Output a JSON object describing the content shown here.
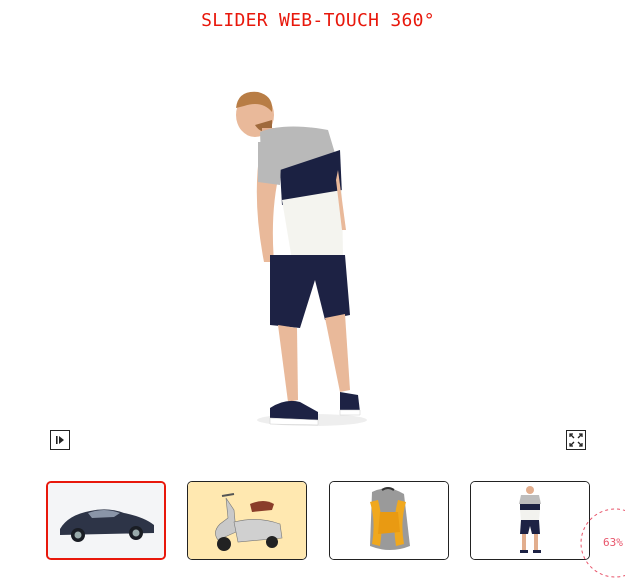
{
  "page": {
    "title": "SLIDER WEB-TOUCH 360°"
  },
  "viewer": {
    "current_item": "t-shirt-model",
    "controls": {
      "play_icon": "play-pause-icon",
      "fullscreen_icon": "fullscreen-icon"
    }
  },
  "thumbnails": [
    {
      "name": "car",
      "active": true,
      "background": "#ffffff"
    },
    {
      "name": "scooter",
      "active": false,
      "background": "#ffe8b0"
    },
    {
      "name": "backpack",
      "active": false,
      "background": "#ffffff"
    },
    {
      "name": "t-shirt-model",
      "active": false,
      "background": "#ffffff"
    }
  ],
  "loader": {
    "progress": 63,
    "label": "63%"
  },
  "colors": {
    "accent": "#e8180c",
    "loader": "#e8546a"
  }
}
